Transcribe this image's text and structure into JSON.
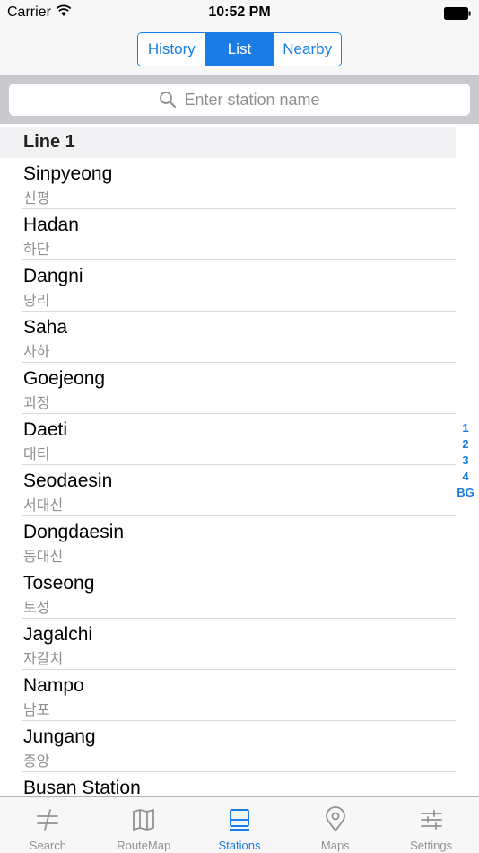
{
  "status_bar": {
    "carrier": "Carrier",
    "time": "10:52 PM"
  },
  "segmented_control": {
    "segments": [
      {
        "label": "History",
        "selected": false
      },
      {
        "label": "List",
        "selected": true
      },
      {
        "label": "Nearby",
        "selected": false
      }
    ]
  },
  "search": {
    "placeholder": "Enter station name"
  },
  "list": {
    "section_title": "Line 1",
    "stations": [
      {
        "name": "Sinpyeong",
        "korean": "신평"
      },
      {
        "name": "Hadan",
        "korean": "하단"
      },
      {
        "name": "Dangni",
        "korean": "당리"
      },
      {
        "name": "Saha",
        "korean": "사하"
      },
      {
        "name": "Goejeong",
        "korean": "괴정"
      },
      {
        "name": "Daeti",
        "korean": "대티"
      },
      {
        "name": "Seodaesin",
        "korean": "서대신"
      },
      {
        "name": "Dongdaesin",
        "korean": "동대신"
      },
      {
        "name": "Toseong",
        "korean": "토성"
      },
      {
        "name": "Jagalchi",
        "korean": "자갈치"
      },
      {
        "name": "Nampo",
        "korean": "남포"
      },
      {
        "name": "Jungang",
        "korean": "중앙"
      },
      {
        "name": "Busan Station",
        "korean": ""
      }
    ]
  },
  "index_bar": [
    "1",
    "2",
    "3",
    "4",
    "BG"
  ],
  "tab_bar": {
    "tabs": [
      {
        "label": "Search",
        "icon": "search-arrows-icon",
        "active": false
      },
      {
        "label": "RouteMap",
        "icon": "map-icon",
        "active": false
      },
      {
        "label": "Stations",
        "icon": "stations-icon",
        "active": true
      },
      {
        "label": "Maps",
        "icon": "location-pin-icon",
        "active": false
      },
      {
        "label": "Settings",
        "icon": "sliders-icon",
        "active": false
      }
    ]
  },
  "colors": {
    "accent": "#1a7de6",
    "inactive_tab": "#929292"
  }
}
